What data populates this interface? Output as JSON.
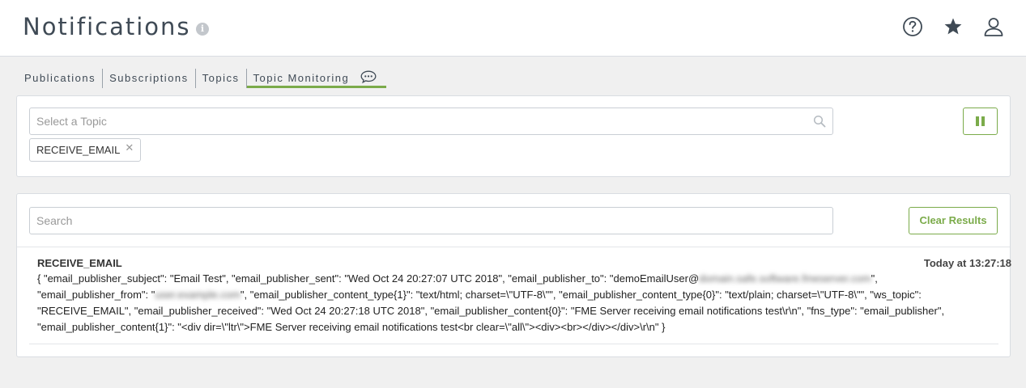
{
  "header": {
    "title": "Notifications",
    "info_glyph": "i",
    "icons": [
      "help-icon",
      "star-icon",
      "user-icon"
    ]
  },
  "tabs": [
    {
      "label": "Publications"
    },
    {
      "label": "Subscriptions"
    },
    {
      "label": "Topics"
    },
    {
      "label": "Topic Monitoring",
      "active": true
    }
  ],
  "topic_panel": {
    "placeholder": "Select a Topic",
    "selected_tag": "RECEIVE_EMAIL",
    "tag_remove": "✕"
  },
  "results_panel": {
    "search_placeholder": "Search",
    "clear_label": "Clear Results",
    "result": {
      "topic": "RECEIVE_EMAIL",
      "time": "Today at 13:27:18",
      "body_1": "{ \"email_publisher_subject\": \"Email Test\", \"email_publisher_sent\": \"Wed Oct 24 20:27:07 UTC 2018\", \"email_publisher_to\": \"demoEmailUser@",
      "body_2": "\", ",
      "body_3": "\"email_publisher_from\": \"",
      "body_4": "\", \"email_publisher_content_type{1}\": \"text/html; charset=\\\"UTF-8\\\"\", \"email_publisher_content_type{0}\": \"text/plain; charset=\\\"UTF-8\\\"\", \"ws_topic\": \"RECEIVE_EMAIL\", \"email_publisher_received\": \"Wed Oct 24 20:27:18 UTC 2018\", \"email_publisher_content{0}\": \"FME Server receiving email notifications test\\r\\n\", \"fns_type\": \"email_publisher\", \"email_publisher_content{1}\": \"<div dir=\\\"ltr\\\">FME Server receiving email notifications test<br clear=\\\"all\\\"><div><br></div></div>\\r\\n\" }",
      "blur_1": "domain.safe.software.fmeserver.com",
      "blur_2": "user.example.com"
    }
  },
  "colors": {
    "accent": "#7bab4a",
    "title": "#3f4a55",
    "background": "#f0f0f0"
  }
}
